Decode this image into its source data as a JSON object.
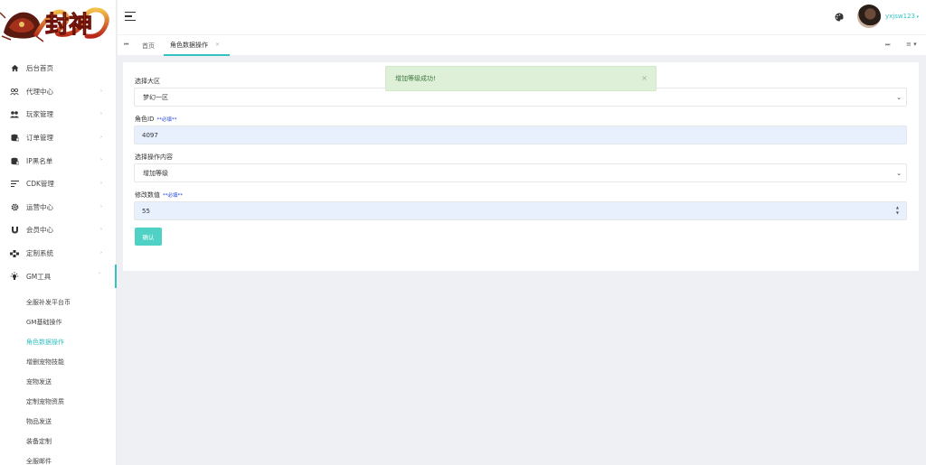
{
  "logo": {
    "text": "封神"
  },
  "sidebar": {
    "items": [
      {
        "label": "后台首页",
        "icon": "home-icon"
      },
      {
        "label": "代理中心",
        "icon": "users-icon"
      },
      {
        "label": "玩家管理",
        "icon": "people-icon"
      },
      {
        "label": "订单管理",
        "icon": "database-icon"
      },
      {
        "label": "IP黑名单",
        "icon": "database-icon"
      },
      {
        "label": "CDK管理",
        "icon": "list-icon"
      },
      {
        "label": "运营中心",
        "icon": "gear-icon"
      },
      {
        "label": "会员中心",
        "icon": "magnet-icon"
      },
      {
        "label": "定制系统",
        "icon": "gamepad-icon"
      },
      {
        "label": "GM工具",
        "icon": "bulb-icon"
      }
    ],
    "sub_items": [
      "全服补发平台币",
      "GM基础操作",
      "角色数据操作",
      "增删宠物技能",
      "宠物发送",
      "定制宠物资质",
      "物品发送",
      "装备定制",
      "全服邮件"
    ]
  },
  "header": {
    "username": "yxjsw123"
  },
  "tabs": {
    "home": "首页",
    "active": "角色数据操作"
  },
  "form": {
    "server_label": "选择大区",
    "server_value": "梦幻一区",
    "role_label": "角色ID",
    "role_req": "**必填**",
    "role_value": "4097",
    "op_label": "选择操作内容",
    "op_value": "增加等级",
    "num_label": "修改数值",
    "num_req": "**必填**",
    "num_value": "55",
    "confirm": "确认"
  },
  "toast": {
    "message": "增加等级成功!",
    "close": "×"
  },
  "colors": {
    "accent": "#35c2c0",
    "button": "#4fd1c5",
    "toast_bg": "#dff0d8",
    "toast_text": "#3c763d"
  }
}
